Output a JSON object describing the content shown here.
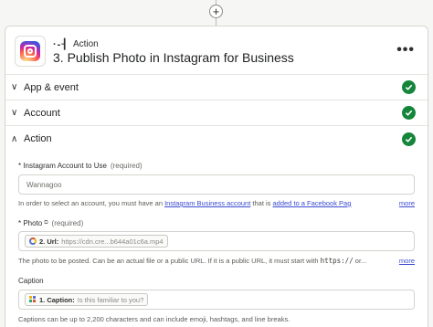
{
  "add_step_symbol": "+",
  "header": {
    "step_type": "Action",
    "title": "3. Publish Photo in Instagram for Business",
    "more_label": "•••"
  },
  "sections": [
    {
      "label": "App & event",
      "state": "collapsed",
      "complete": true
    },
    {
      "label": "Account",
      "state": "collapsed",
      "complete": true
    },
    {
      "label": "Action",
      "state": "expanded",
      "complete": true
    }
  ],
  "fields": {
    "account": {
      "label": "* Instagram Account to Use",
      "required": "(required)",
      "value": "Wannagoo",
      "help_prefix": "In order to select an account, you must have an ",
      "help_link1": "Instagram Business account",
      "help_middle": " that is ",
      "help_link2": "added to a Facebook Pag",
      "more": "more"
    },
    "photo": {
      "label": "* Photo",
      "required": "(required)",
      "chip_label": "2. Url:",
      "chip_value": "https://cdn.cre...b644a01c6a.mp4",
      "help_prefix": "The photo to be posted. Can be an actual file or a public URL. If it is a public URL, it must start with ",
      "help_code": "https://",
      "help_suffix": " or...",
      "more": "more"
    },
    "caption": {
      "label": "Caption",
      "chip_label": "1. Caption:",
      "chip_value": "Is this familiar to you?",
      "help": "Captions can be up to 2,200 characters and can include emoji, hashtags, and line breaks."
    }
  },
  "colors": {
    "check_green": "#14853b",
    "link_blue": "#3b4bd1"
  }
}
